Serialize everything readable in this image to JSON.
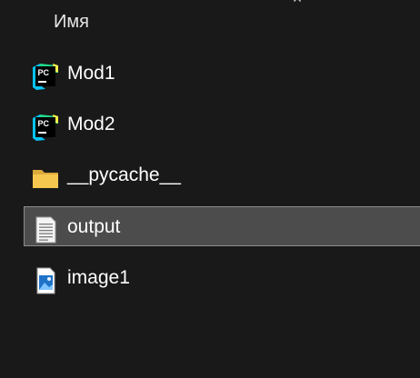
{
  "header": {
    "name_column": "Имя",
    "close_glyph": "×"
  },
  "files": [
    {
      "name": "Mod1",
      "icon": "pycharm-icon",
      "selected": false
    },
    {
      "name": "Mod2",
      "icon": "pycharm-icon",
      "selected": false
    },
    {
      "name": "__pycache__",
      "icon": "folder-icon",
      "selected": false
    },
    {
      "name": "output",
      "icon": "text-document-icon",
      "selected": true
    },
    {
      "name": "image1",
      "icon": "image-file-icon",
      "selected": false
    }
  ],
  "colors": {
    "background": "#191919",
    "selection_background": "#4c4c4c",
    "selection_border": "#8c8c8c",
    "folder": "#f0c24b",
    "pycharm_badge": "#000000",
    "pycharm_green": "#21d789",
    "pycharm_blue": "#07c3f2",
    "pycharm_yellow": "#fcf84a"
  }
}
